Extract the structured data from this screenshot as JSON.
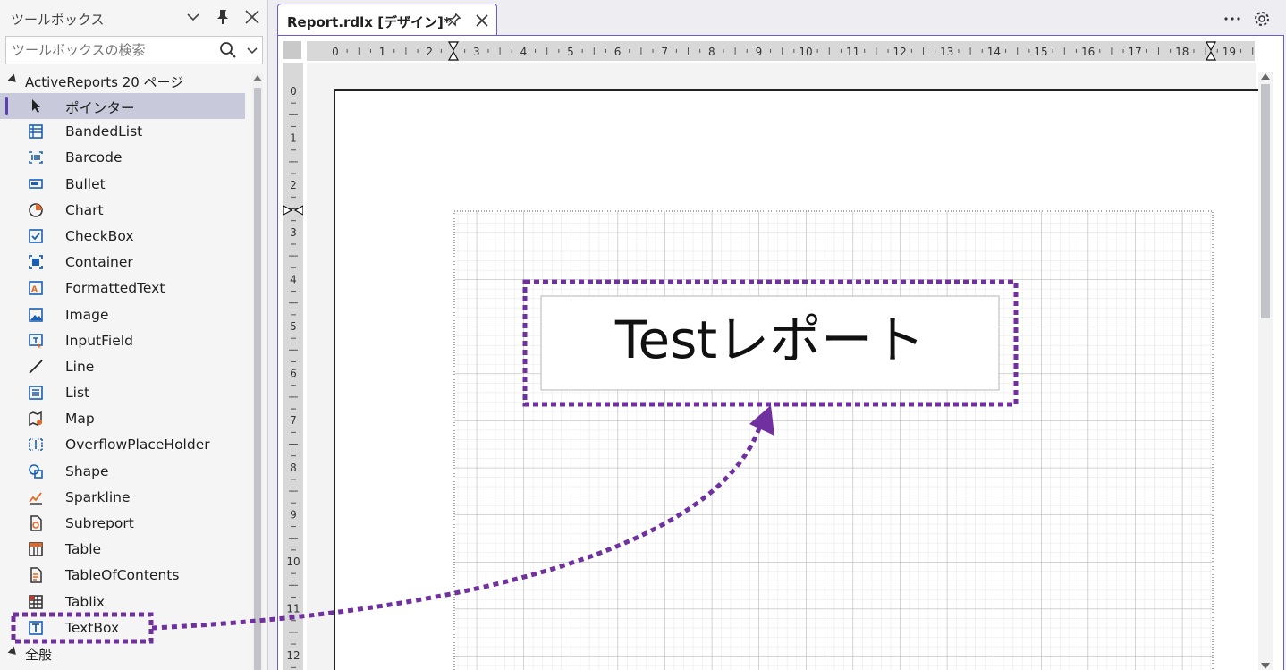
{
  "toolbox": {
    "title": "ツールボックス",
    "search_placeholder": "ツールボックスの検索",
    "group_label": "ActiveReports 20 ページ",
    "general_group": "全般",
    "items": [
      {
        "label": "ポインター",
        "icon": "pointer-icon"
      },
      {
        "label": "BandedList",
        "icon": "bandedlist-icon"
      },
      {
        "label": "Barcode",
        "icon": "barcode-icon"
      },
      {
        "label": "Bullet",
        "icon": "bullet-icon"
      },
      {
        "label": "Chart",
        "icon": "chart-icon"
      },
      {
        "label": "CheckBox",
        "icon": "checkbox-icon"
      },
      {
        "label": "Container",
        "icon": "container-icon"
      },
      {
        "label": "FormattedText",
        "icon": "formattedtext-icon"
      },
      {
        "label": "Image",
        "icon": "image-icon"
      },
      {
        "label": "InputField",
        "icon": "inputfield-icon"
      },
      {
        "label": "Line",
        "icon": "line-icon"
      },
      {
        "label": "List",
        "icon": "list-icon"
      },
      {
        "label": "Map",
        "icon": "map-icon"
      },
      {
        "label": "OverflowPlaceHolder",
        "icon": "overflowplaceholder-icon"
      },
      {
        "label": "Shape",
        "icon": "shape-icon"
      },
      {
        "label": "Sparkline",
        "icon": "sparkline-icon"
      },
      {
        "label": "Subreport",
        "icon": "subreport-icon"
      },
      {
        "label": "Table",
        "icon": "table-icon"
      },
      {
        "label": "TableOfContents",
        "icon": "tableofcontents-icon"
      },
      {
        "label": "Tablix",
        "icon": "tablix-icon"
      },
      {
        "label": "TextBox",
        "icon": "textbox-icon"
      }
    ],
    "selected_index": 0
  },
  "designer": {
    "tab_label": "Report.rdlx [デザイン]*",
    "ruler_top": [
      "0",
      "1",
      "2",
      "3",
      "4",
      "5",
      "6",
      "7",
      "8",
      "9",
      "10",
      "11",
      "12",
      "13",
      "14",
      "15",
      "16",
      "17",
      "18",
      "19"
    ],
    "ruler_left": [
      "0",
      "1",
      "2",
      "3",
      "4",
      "5",
      "6",
      "7",
      "8",
      "9",
      "10",
      "11",
      "12"
    ],
    "textbox_text": "Testレポート"
  },
  "colors": {
    "accent": "#6b5bd0",
    "highlight_dots": "#7030a0",
    "selected_row": "#c9c9dc"
  }
}
